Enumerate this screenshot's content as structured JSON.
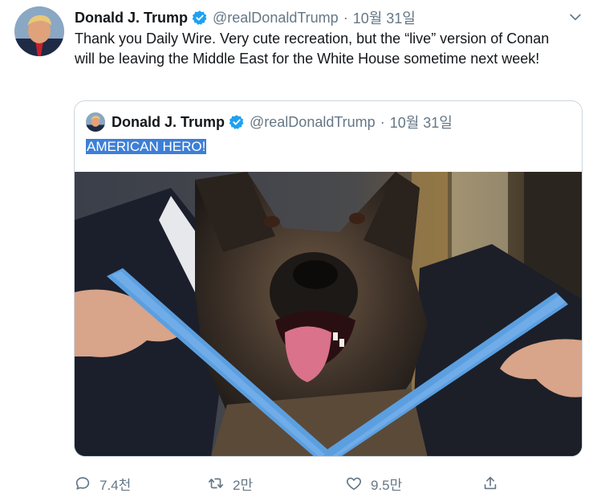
{
  "tweet": {
    "author_name": "Donald J. Trump",
    "handle": "@realDonaldTrump",
    "separator": "·",
    "date": "10월 31일",
    "text": "Thank you Daily Wire. Very cute recreation, but the “live” version of Conan will be leaving the Middle East for the White House sometime next week!"
  },
  "quoted": {
    "author_name": "Donald J. Trump",
    "handle": "@realDonaldTrump",
    "separator": "·",
    "date": "10월 31일",
    "text": "AMERICAN HERO!"
  },
  "actions": {
    "reply_count": "7.4천",
    "retweet_count": "2만",
    "like_count": "9.5만"
  },
  "colors": {
    "verified": "#1da1f2",
    "secondary_text": "#657786",
    "selection": "#3d7fd6",
    "medal_ribbon": "#5b9fe0"
  },
  "icons": [
    "verified-badge-icon",
    "chevron-down-icon",
    "reply-icon",
    "retweet-icon",
    "like-icon",
    "share-icon"
  ]
}
